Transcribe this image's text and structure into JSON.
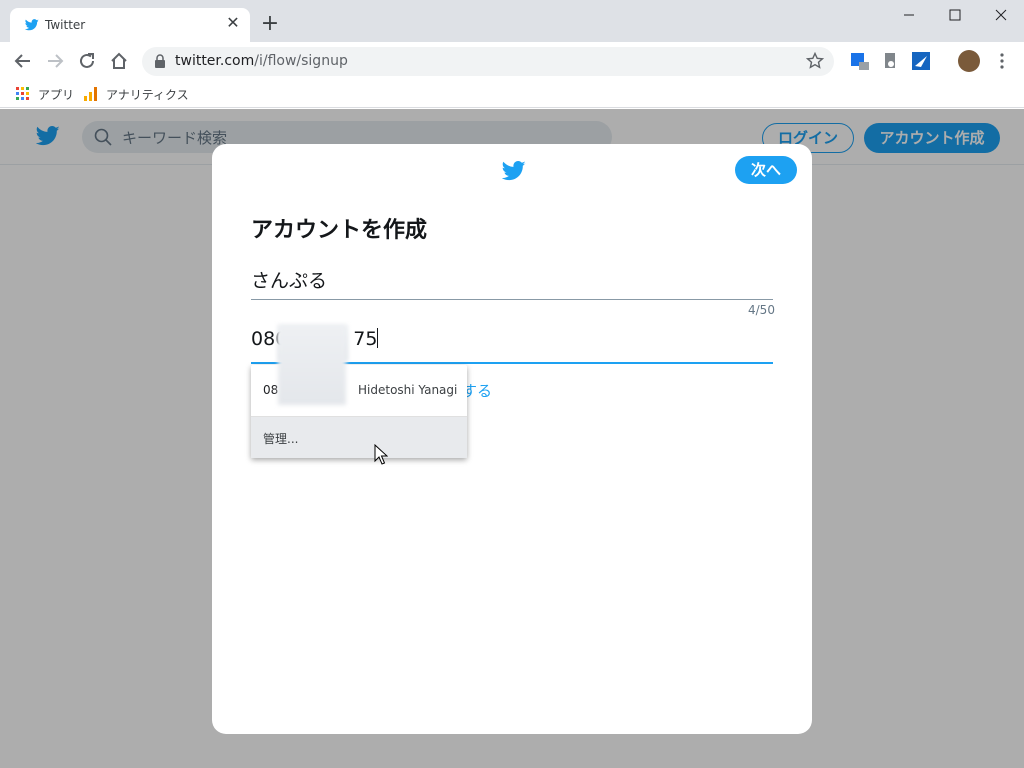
{
  "browser": {
    "tab_title": "Twitter",
    "tab_close": "✕",
    "new_tab": "+",
    "url_host": "twitter.com",
    "url_path": "/i/flow/signup",
    "bookmarks": [
      {
        "label": "アプリ",
        "icon": "apps-grid-icon"
      },
      {
        "label": "アナリティクス",
        "icon": "analytics-icon"
      }
    ]
  },
  "header": {
    "search_placeholder": "キーワード検索",
    "login_label": "ログイン",
    "signup_label": "アカウント作成"
  },
  "modal": {
    "next_label": "次へ",
    "title": "アカウントを作成",
    "name_value": "さんぷる",
    "name_counter": "4/50",
    "phone_prefix": "080",
    "phone_suffix": "75",
    "email_link_partial": "する"
  },
  "autocomplete": {
    "phone_partial": "08",
    "contact_name": "Hidetoshi Yanagi",
    "manage_label": "管理..."
  },
  "colors": {
    "twitter_blue": "#1da1f2",
    "overlay": "rgba(0,0,0,0.32)"
  }
}
